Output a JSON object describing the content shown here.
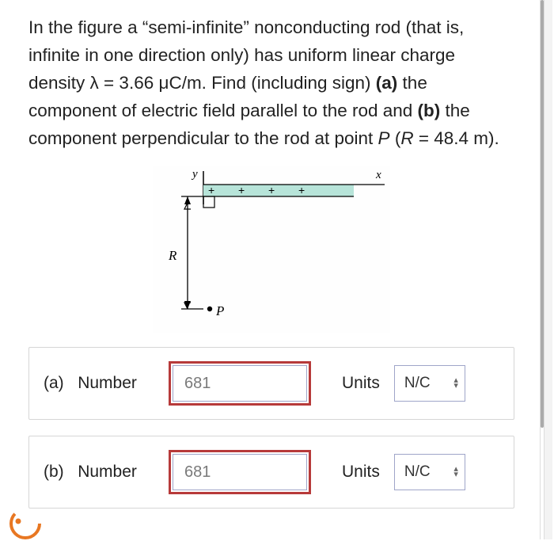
{
  "problem": {
    "full_text": "In the figure a “semi-infinite” nonconducting rod (that is, infinite in one direction only) has uniform linear charge density λ = 3.66 μC/m. Find (including sign) (a) the component of electric field parallel to the rod and (b) the component perpendicular to the rod at point P (R = 48.4 m).",
    "seg1": "In the figure a “semi-infinite” nonconducting rod (that is, infinite in one direction only) has uniform linear charge density λ = 3.66 μC/m. Find (including sign) ",
    "part_a_label": "(a)",
    "seg2": " the component of electric field parallel to the rod and ",
    "part_b_label": "(b)",
    "seg3": " the component perpendicular to the rod at point ",
    "point_var": "P",
    "seg4": " (",
    "r_var": "R",
    "seg5": " = 48.4 m).",
    "lambda_value": 3.66,
    "lambda_unit": "μC/m",
    "R_value": 48.4,
    "R_unit": "m"
  },
  "figure": {
    "y_label": "y",
    "x_label": "x",
    "R_label": "R",
    "P_label": "P",
    "plus": "+"
  },
  "answers": {
    "a": {
      "prefix": "(a)",
      "label": "Number",
      "value": "681",
      "units_label": "Units",
      "units_value": "N/C"
    },
    "b": {
      "prefix": "(b)",
      "label": "Number",
      "value": "681",
      "units_label": "Units",
      "units_value": "N/C"
    }
  }
}
